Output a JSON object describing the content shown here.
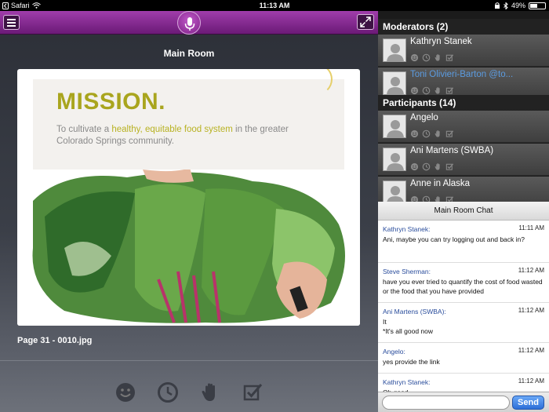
{
  "status_bar": {
    "back_app": "Safari",
    "time": "11:13 AM",
    "battery": "49%",
    "battery_fraction": 0.49
  },
  "main": {
    "room_title": "Main Room",
    "page_label": "Page 31 - 0010.jpg",
    "slide": {
      "heading": "MISSION.",
      "sub_before": "To cultivate a ",
      "sub_highlight": "healthy, equitable food system",
      "sub_after": " in the greater Colorado Springs community."
    }
  },
  "moderators": {
    "header": "Moderators (2)",
    "people": [
      {
        "name": "Kathryn Stanek",
        "link": false
      },
      {
        "name": "Toni Olivieri-Barton @to...",
        "link": true
      }
    ]
  },
  "participants": {
    "header": "Participants (14)",
    "people": [
      {
        "name": "Angelo",
        "link": false
      },
      {
        "name": "Ani Martens (SWBA)",
        "link": false
      },
      {
        "name": "Anne in Alaska",
        "link": false
      }
    ]
  },
  "chat": {
    "title": "Main Room Chat",
    "messages": [
      {
        "sender": "Kathryn Stanek:",
        "time": "11:11 AM",
        "text": "Ani, maybe you can try logging out and back in?"
      },
      {
        "sender": "Steve Sherman:",
        "time": "11:12 AM",
        "text": "have you ever tried to quantify the cost of food wasted or the food that you have provided"
      },
      {
        "sender": "Ani Martens (SWBA):",
        "time": "11:12 AM",
        "text": "It\n*It's all good now"
      },
      {
        "sender": "Angelo:",
        "time": "11:12 AM",
        "text": "yes provide the link"
      },
      {
        "sender": "Kathryn Stanek:",
        "time": "11:12 AM",
        "text": "Oh good"
      }
    ],
    "input_placeholder": "",
    "send_label": "Send"
  },
  "colors": {
    "accent_purple": "#8e2a9a",
    "link_blue": "#5b9be0",
    "send_blue": "#2d6fd8"
  }
}
